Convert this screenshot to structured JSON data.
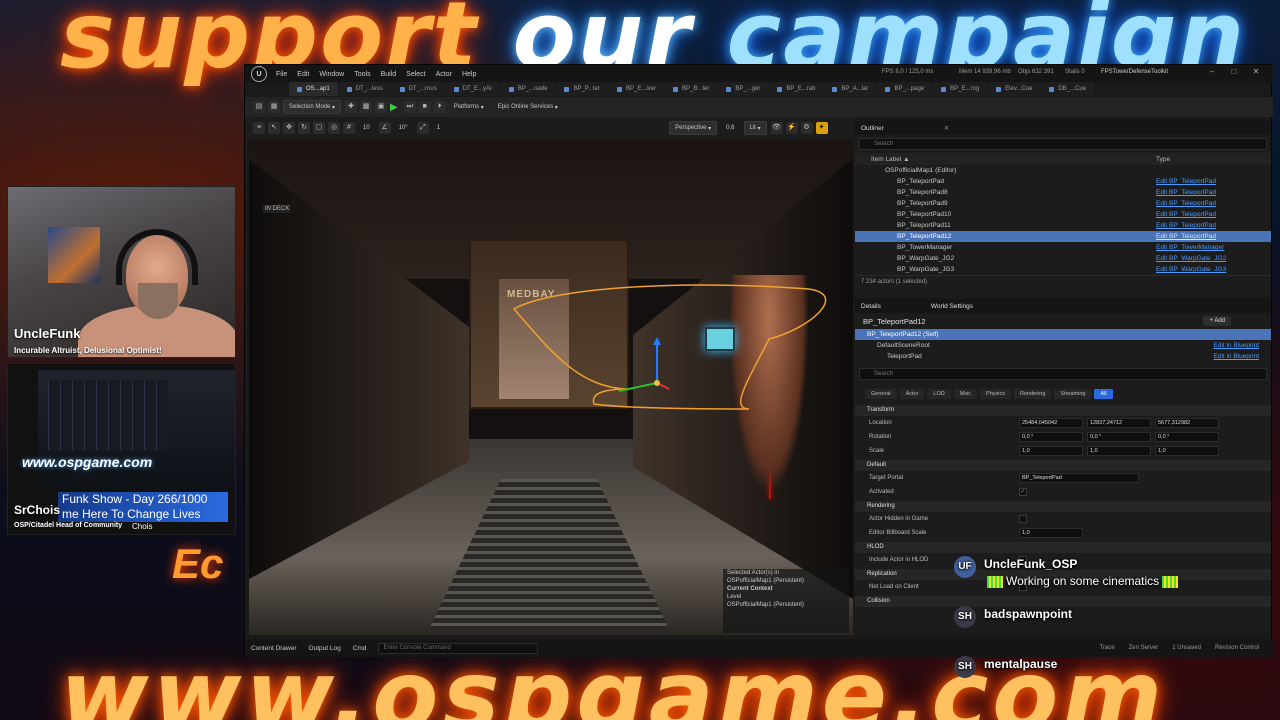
{
  "background": {
    "headline_words": [
      "support",
      "our",
      "campaign"
    ],
    "url_text": "www.ospgame.com",
    "side_text": "Ec"
  },
  "webcam": {
    "name": "UncleFunk",
    "tagline": "Incurable Altruist, Delusional Optimist!"
  },
  "cam2": {
    "url": "www.ospgame.com",
    "ticker_line1": "Funk Show - Day 266/1000",
    "ticker_line2": "me Here To Change Lives",
    "name": "SrChois",
    "tagline": "OSP/Citadel Head of Community",
    "chois": "Chois"
  },
  "editor": {
    "logo": "U",
    "menu": [
      "File",
      "Edit",
      "Window",
      "Tools",
      "Build",
      "Select",
      "Actor",
      "Help"
    ],
    "status": {
      "fps": "FPS 8,0 / 125,0 ms",
      "mem": "Mem 14 939,96 mb",
      "objs": "Objs 632 391",
      "stalls": "Stalls 0",
      "project": "FPSTowerDefenseToolkit"
    },
    "tabs": [
      "OS...ap1",
      "DT_...less",
      "DT_...rnus",
      "DT_E...yAI",
      "BP_...nade",
      "BP_P...ter",
      "BP_E...iver",
      "BP_B...ter",
      "BP_...ger",
      "BP_E...rab",
      "BP_A...lar",
      "BP_...page",
      "BP_E...rog",
      "Elev...Cue",
      "DB_...Cue"
    ],
    "window_buttons": [
      "–",
      "□",
      "✕"
    ],
    "toolbar": {
      "selection_mode": "Selection Mode",
      "platforms": "Platforms",
      "epic_services": "Epic Online Services"
    },
    "viewport_tools": {
      "perspective": "Perspective",
      "lit": "Lit",
      "fov": "0,6",
      "snap_angle": "10°",
      "grid": "10",
      "scale_snap": "1"
    },
    "viewport": {
      "door_sign": "MEDBAY",
      "wall_sign": "IN DECK",
      "context": {
        "selected": "Selected Actor(s) in",
        "selected_map": "OSPofficialMap1 (Persistent)",
        "current_context": "Current Context",
        "level": "Level",
        "level_map": "OSPofficialMap1 (Persistent)"
      }
    },
    "outliner": {
      "tab": "Outliner",
      "search_placeholder": "Search",
      "col_item": "Item Label ▲",
      "col_type": "Type",
      "root": "OSPofficialMap1 (Editor)",
      "rows": [
        {
          "label": "BP_TeleportPad",
          "type": "Edit BP_TeleportPad"
        },
        {
          "label": "BP_TeleportPad8",
          "type": "Edit BP_TeleportPad"
        },
        {
          "label": "BP_TeleportPad9",
          "type": "Edit BP_TeleportPad"
        },
        {
          "label": "BP_TeleportPad10",
          "type": "Edit BP_TeleportPad"
        },
        {
          "label": "BP_TeleportPad11",
          "type": "Edit BP_TeleportPad"
        },
        {
          "label": "BP_TeleportPad12",
          "type": "Edit BP_TeleportPad"
        },
        {
          "label": "BP_TowerManager",
          "type": "Edit BP_TowerManager"
        },
        {
          "label": "BP_WarpGate_JG2",
          "type": "Edit BP_WarpGate_JG2"
        },
        {
          "label": "BP_WarpGate_JG3",
          "type": "Edit BP_WarpGate_JG3"
        }
      ],
      "selected_index": 5,
      "footer": "7 234 actors (1 selected)"
    },
    "details": {
      "tab": "Details",
      "tab2": "World Settings",
      "title": "BP_TeleportPad12",
      "add": "+ Add",
      "components": [
        {
          "label": "BP_TeleportPad12 (Self)",
          "link": ""
        },
        {
          "label": "DefaultSceneRoot",
          "link": "Edit in Blueprint"
        },
        {
          "label": "TeleportPad",
          "link": "Edit in Blueprint"
        }
      ],
      "search_placeholder": "Search",
      "filters": [
        "General",
        "Actor",
        "LOD",
        "Misc",
        "Physics",
        "Rendering",
        "Streaming",
        "All"
      ],
      "active_filter": "All",
      "transform_cat": "Transform",
      "location_label": "Location",
      "location": [
        "25484,045042",
        "12837,24712",
        "5677,312982"
      ],
      "rotation_label": "Rotation",
      "rotation": [
        "0,0 °",
        "0,0 °",
        "0,0 °"
      ],
      "scale_label": "Scale",
      "scale": [
        "1,0",
        "1,0",
        "1,0"
      ],
      "default_cat": "Default",
      "target_portal_label": "Target Portal",
      "target_portal": "BP_TeleportPad",
      "activated_label": "Activated",
      "activated": "✓",
      "rendering_cat": "Rendering",
      "hidden_label": "Actor Hidden in Game",
      "billboard_label": "Editor Billboard Scale",
      "billboard": "1,0",
      "hlod_cat": "HLOD",
      "include_label": "Include Actor in HLOD",
      "replication_cat": "Replication",
      "netload_label": "Net Load on Client",
      "collision_cat": "Collision"
    },
    "bottom": {
      "content_drawer": "Content Drawer",
      "output_log": "Output Log",
      "cmd": "Cmd",
      "console_placeholder": "Enter Console Command",
      "trace": "Trace",
      "derived": "Zen Server",
      "unsaved": "1 Unsaved",
      "revision": "Revision Control"
    }
  },
  "chat": [
    {
      "avatar": "UF",
      "user": "UncleFunk_OSP",
      "message": "Working on some cinematics"
    },
    {
      "avatar": "SH",
      "user": "badspawnpoint",
      "message": ""
    },
    {
      "avatar": "SH",
      "user": "mentalpause",
      "message": ""
    }
  ],
  "colors": {
    "accent_blue": "#4a73b8",
    "link_blue": "#4a9cff",
    "headline_orange": "#ffb24a",
    "headline_blue": "#9fe0ff",
    "play_green": "#3ad03a"
  }
}
